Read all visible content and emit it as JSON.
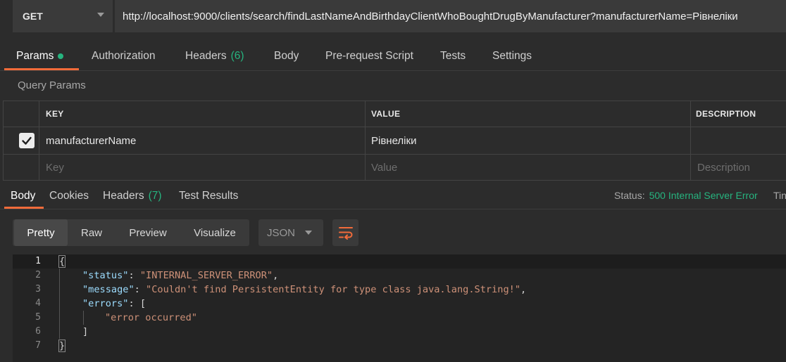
{
  "request": {
    "method": "GET",
    "url": "http://localhost:9000/clients/search/findLastNameAndBirthdayClientWhoBoughtDrugByManufacturer?manufacturerName=Рівнеліки"
  },
  "request_tabs": [
    {
      "label": "Params",
      "active": true,
      "dot": true
    },
    {
      "label": "Authorization"
    },
    {
      "label": "Headers",
      "count": "(6)"
    },
    {
      "label": "Body"
    },
    {
      "label": "Pre-request Script"
    },
    {
      "label": "Tests"
    },
    {
      "label": "Settings"
    }
  ],
  "query_params": {
    "title": "Query Params",
    "headers": {
      "key": "KEY",
      "value": "VALUE",
      "description": "DESCRIPTION"
    },
    "rows": [
      {
        "checked": true,
        "key": "manufacturerName",
        "value": "Рівнеліки",
        "description": ""
      }
    ],
    "placeholder": {
      "key": "Key",
      "value": "Value",
      "description": "Description"
    }
  },
  "response_tabs": [
    {
      "label": "Body",
      "active": true
    },
    {
      "label": "Cookies"
    },
    {
      "label": "Headers",
      "count": "(7)"
    },
    {
      "label": "Test Results"
    }
  ],
  "status": {
    "label": "Status:",
    "value": "500 Internal Server Error",
    "time_label": "Tin"
  },
  "view_modes": [
    "Pretty",
    "Raw",
    "Preview",
    "Visualize"
  ],
  "active_view": "Pretty",
  "format": "JSON",
  "icons": {
    "method_caret": "chevron-down-icon",
    "format_caret": "chevron-down-icon",
    "wrap": "wrap-lines-icon",
    "checkbox": "checkmark-icon"
  },
  "colors": {
    "accent": "#f26b3a",
    "success": "#26b47f",
    "json_key": "#9cdcfe",
    "json_string": "#ce9178"
  },
  "code": {
    "line_numbers": [
      "1",
      "2",
      "3",
      "4",
      "5",
      "6",
      "7"
    ],
    "lines": {
      "l1": "{",
      "l2_key": "\"status\"",
      "l2_sep": ": ",
      "l2_val": "\"INTERNAL_SERVER_ERROR\"",
      "l2_end": ",",
      "l3_key": "\"message\"",
      "l3_sep": ": ",
      "l3_val": "\"Couldn't find PersistentEntity for type class java.lang.String!\"",
      "l3_end": ",",
      "l4_key": "\"errors\"",
      "l4_sep": ": [",
      "l5_val": "\"error occurred\"",
      "l6": "]",
      "l7": "}"
    }
  }
}
